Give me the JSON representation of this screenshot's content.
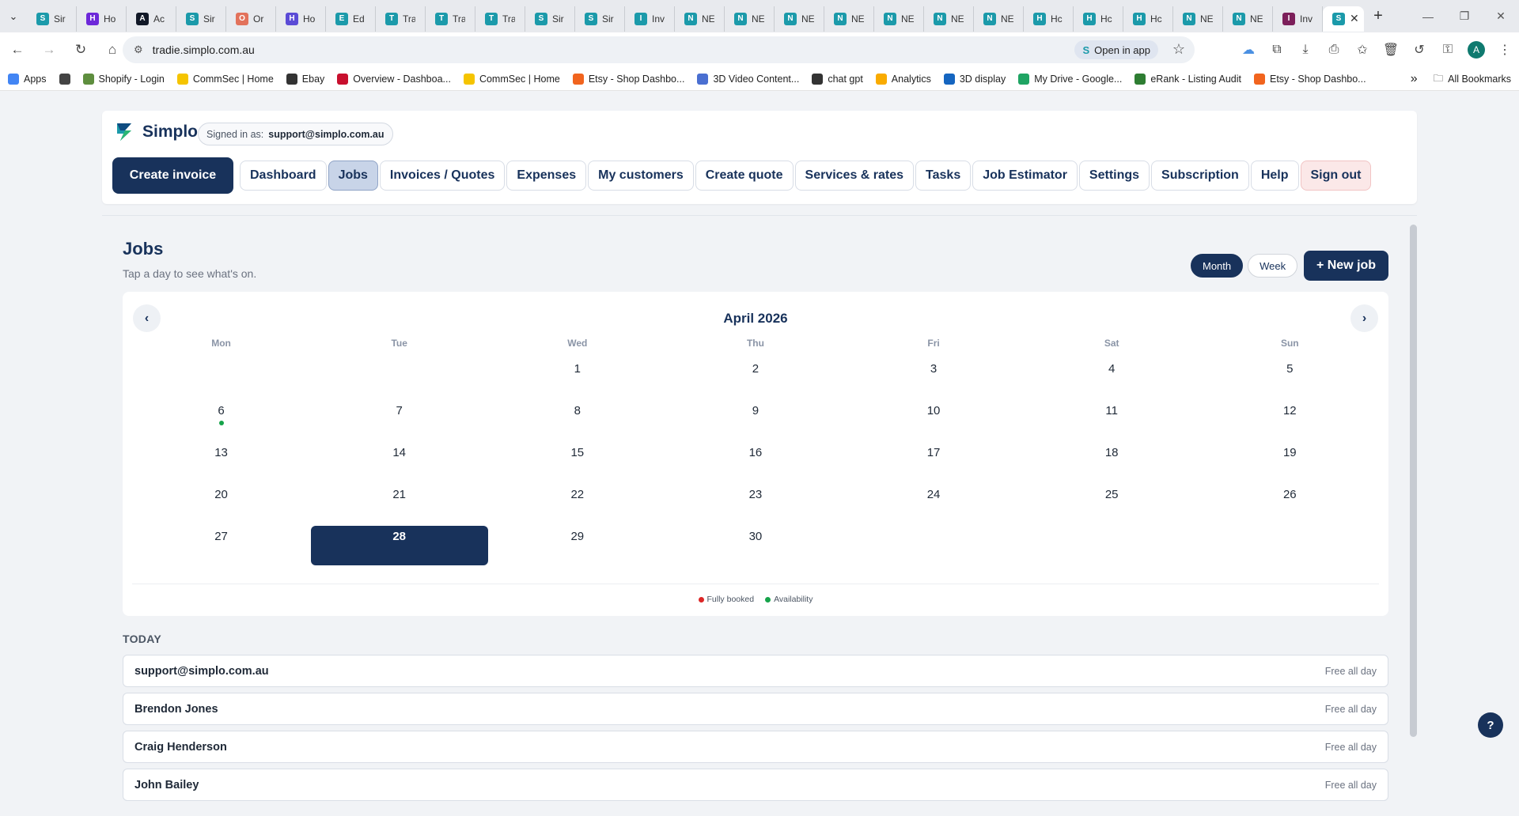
{
  "browser": {
    "tabs": [
      {
        "title": "Sir",
        "icon": "simplo-favicon",
        "color": "#1b9aaa"
      },
      {
        "title": "Ho",
        "icon": "purple-favicon",
        "color": "#6d28d9"
      },
      {
        "title": "Ac",
        "icon": "chart-favicon",
        "color": "#111827"
      },
      {
        "title": "Sir",
        "icon": "simplo-favicon",
        "color": "#1b9aaa"
      },
      {
        "title": "Or",
        "icon": "sunburst-favicon",
        "color": "#e2725b"
      },
      {
        "title": "Ho",
        "icon": "purple-favicon",
        "color": "#5b4bd6"
      },
      {
        "title": "Ed",
        "icon": "simplo-favicon",
        "color": "#1b9aaa"
      },
      {
        "title": "Tra",
        "icon": "simplo-favicon",
        "color": "#1b9aaa"
      },
      {
        "title": "Tra",
        "icon": "simplo-favicon",
        "color": "#1b9aaa"
      },
      {
        "title": "Tra",
        "icon": "simplo-favicon",
        "color": "#1b9aaa"
      },
      {
        "title": "Sir",
        "icon": "simplo-favicon",
        "color": "#1b9aaa"
      },
      {
        "title": "Sir",
        "icon": "simplo-favicon",
        "color": "#1b9aaa"
      },
      {
        "title": "Inv",
        "icon": "simplo-favicon",
        "color": "#1b9aaa"
      },
      {
        "title": "NE",
        "icon": "simplo-favicon",
        "color": "#1b9aaa"
      },
      {
        "title": "NE",
        "icon": "simplo-favicon",
        "color": "#1b9aaa"
      },
      {
        "title": "NE",
        "icon": "simplo-favicon",
        "color": "#1b9aaa"
      },
      {
        "title": "NE",
        "icon": "simplo-favicon",
        "color": "#1b9aaa"
      },
      {
        "title": "NE",
        "icon": "simplo-favicon",
        "color": "#1b9aaa"
      },
      {
        "title": "NE",
        "icon": "simplo-favicon",
        "color": "#1b9aaa"
      },
      {
        "title": "NE",
        "icon": "simplo-favicon",
        "color": "#1b9aaa"
      },
      {
        "title": "Hc",
        "icon": "simplo-favicon",
        "color": "#1b9aaa"
      },
      {
        "title": "Hc",
        "icon": "simplo-favicon",
        "color": "#1b9aaa"
      },
      {
        "title": "Hc",
        "icon": "simplo-favicon",
        "color": "#1b9aaa"
      },
      {
        "title": "NE",
        "icon": "simplo-favicon",
        "color": "#1b9aaa"
      },
      {
        "title": "NE",
        "icon": "simplo-favicon",
        "color": "#1b9aaa"
      },
      {
        "title": "Inv",
        "icon": "notion-favicon",
        "color": "#7c1f5a"
      }
    ],
    "url": "tradie.simplo.com.au",
    "open_in_app": "Open in app",
    "profile_initial": "A",
    "bookmarks": [
      {
        "label": "Apps",
        "icon": "apps-grid-icon",
        "color": "#4285f4"
      },
      {
        "label": "",
        "icon": "grid-icon",
        "color": "#444444"
      },
      {
        "label": "Shopify - Login",
        "icon": "shopify-icon",
        "color": "#5e8e3e"
      },
      {
        "label": "CommSec | Home",
        "icon": "commsec-icon",
        "color": "#f5c400"
      },
      {
        "label": "Ebay",
        "icon": "ebay-icon",
        "color": "#333333"
      },
      {
        "label": "Overview - Dashboa...",
        "icon": "red-circle-icon",
        "color": "#c8102e"
      },
      {
        "label": "CommSec | Home",
        "icon": "commsec-icon",
        "color": "#f5c400"
      },
      {
        "label": "Etsy - Shop Dashbo...",
        "icon": "etsy-icon",
        "color": "#f1641e"
      },
      {
        "label": "3D Video Content...",
        "icon": "video-icon",
        "color": "#4a6fd1"
      },
      {
        "label": "chat gpt",
        "icon": "openai-icon",
        "color": "#333333"
      },
      {
        "label": "Analytics",
        "icon": "analytics-icon",
        "color": "#f9ab00"
      },
      {
        "label": "3D display",
        "icon": "display-icon",
        "color": "#1565c0"
      },
      {
        "label": "My Drive - Google...",
        "icon": "drive-icon",
        "color": "#1fa463"
      },
      {
        "label": "eRank - Listing Audit",
        "icon": "erank-icon",
        "color": "#2e7d32"
      },
      {
        "label": "Etsy - Shop Dashbo...",
        "icon": "etsy-icon",
        "color": "#f1641e"
      }
    ],
    "more_bookmarks": "»",
    "all_bookmarks": "All Bookmarks"
  },
  "app": {
    "brand": "Simplo",
    "signed_in_label": "Signed in as:",
    "signed_in_email": "support@simplo.com.au",
    "create_invoice": "Create invoice",
    "nav": [
      "Dashboard",
      "Jobs",
      "Invoices / Quotes",
      "Expenses",
      "My customers",
      "Create quote",
      "Services & rates",
      "Tasks",
      "Job Estimator",
      "Settings",
      "Subscription",
      "Help"
    ],
    "active_nav": "Jobs",
    "sign_out": "Sign out",
    "brand_color": "#18325b"
  },
  "jobs": {
    "title": "Jobs",
    "subtitle": "Tap a day to see what's on.",
    "view_month": "Month",
    "view_week": "Week",
    "active_view": "Month",
    "new_job": "+ New job",
    "calendar": {
      "prev": "‹",
      "next": "›",
      "month_label": "April 2026",
      "weekdays": [
        "Mon",
        "Tue",
        "Wed",
        "Thu",
        "Fri",
        "Sat",
        "Sun"
      ],
      "leading_blanks": 2,
      "days_in_month": 30,
      "today": 28,
      "availability_days": [
        6
      ],
      "legend": {
        "fully_booked": "Fully booked",
        "availability": "Availability",
        "fully_booked_color": "#dc2626",
        "availability_color": "#16a34a"
      }
    },
    "today_heading": "TODAY",
    "staff": [
      {
        "name": "support@simplo.com.au",
        "status": "Free all day"
      },
      {
        "name": "Brendon Jones",
        "status": "Free all day"
      },
      {
        "name": "Craig Henderson",
        "status": "Free all day"
      },
      {
        "name": "John Bailey",
        "status": "Free all day"
      }
    ],
    "help_fab": "?"
  }
}
